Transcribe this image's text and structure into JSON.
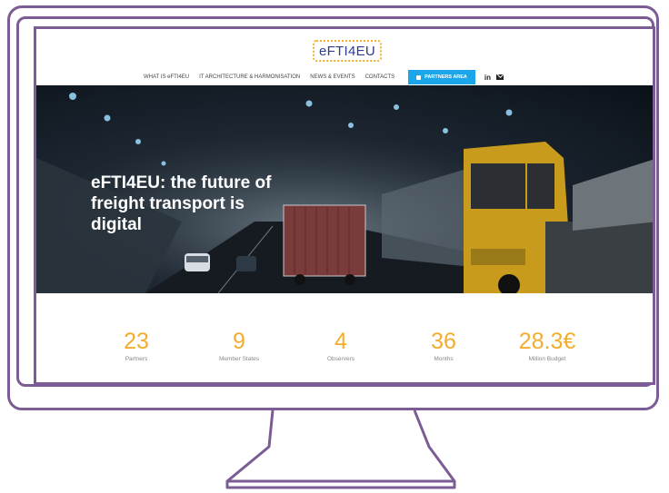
{
  "logo": {
    "text": "eFTI4EU"
  },
  "nav": {
    "items": [
      "WHAT IS eFTI4EU",
      "IT ARCHITECTURE & HARMONISATION",
      "NEWS & EVENTS",
      "CONTACTS"
    ],
    "partners_label": "PARTNERS AREA",
    "social_linkedin": "in"
  },
  "hero": {
    "title_line1": "eFTI4EU: the future of",
    "title_line2": "freight transport is",
    "title_line3": "digital"
  },
  "stats": [
    {
      "value": "23",
      "label": "Partners"
    },
    {
      "value": "9",
      "label": "Member States"
    },
    {
      "value": "4",
      "label": "Observers"
    },
    {
      "value": "36",
      "label": "Months"
    },
    {
      "value": "28.3€",
      "label": "Million Budget"
    }
  ],
  "colors": {
    "frame": "#7b5c94",
    "accent": "#f2ad2e",
    "button": "#1aa6e8",
    "logo_text": "#2f3b8c"
  }
}
